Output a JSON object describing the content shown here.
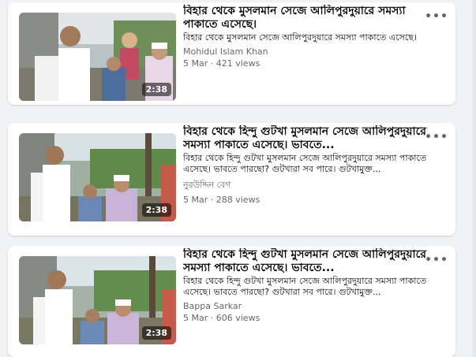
{
  "videos": [
    {
      "title": "বিহার থেকে মুসলমান সেজে আলিপুরদুয়ারে সমস্যা পাকাতে এসেছে।",
      "description": "বিহার থেকে মুসলমান সেজে আলিপুরদুয়ারে সমস্যা পাকাতে এসেছে।",
      "author": "Mohidul Islam Khan",
      "date": "5 Mar",
      "views": "421 views",
      "duration": "2:38"
    },
    {
      "title": "বিহার থেকে হিন্দু গুটখা মুসলমান সেজে আলিপুরদুয়ারে সমস্যা পাকাতে এসেছে। ভাবতে...",
      "description": "বিহার থেকে হিন্দু গুটখা মুসলমান সেজে আলিপুরদুয়ারে সমস্যা পাকাতে এসেছে। ভাবতে পারছো? গুটখারা সব পারে। গুটখামুক্ত...",
      "author": "নুরউদ্দিন বেগ",
      "date": "5 Mar",
      "views": "288 views",
      "duration": "2:38"
    },
    {
      "title": "বিহার থেকে হিন্দু গুটখা মুসলমান সেজে আলিপুরদুয়ারে সমস্যা পাকাতে এসেছে। ভাবতে...",
      "description": "বিহার থেকে হিন্দু গুটখা মুসলমান সেজে আলিপুরদুয়ারে সমস্যা পাকাতে এসেছে। ভাবতে পারছো? গুটখারা সব পারে। গুটখামুক্ত...",
      "author": "Bappa Sarkar",
      "date": "5 Mar",
      "views": "606 views",
      "duration": "2:38"
    }
  ],
  "separator": " · ",
  "icons": {
    "more": "more-options-icon"
  },
  "colors": {
    "background": "#f0f2f5",
    "card": "#ffffff",
    "secondary_text": "#65676b",
    "primary_text": "#050505"
  }
}
